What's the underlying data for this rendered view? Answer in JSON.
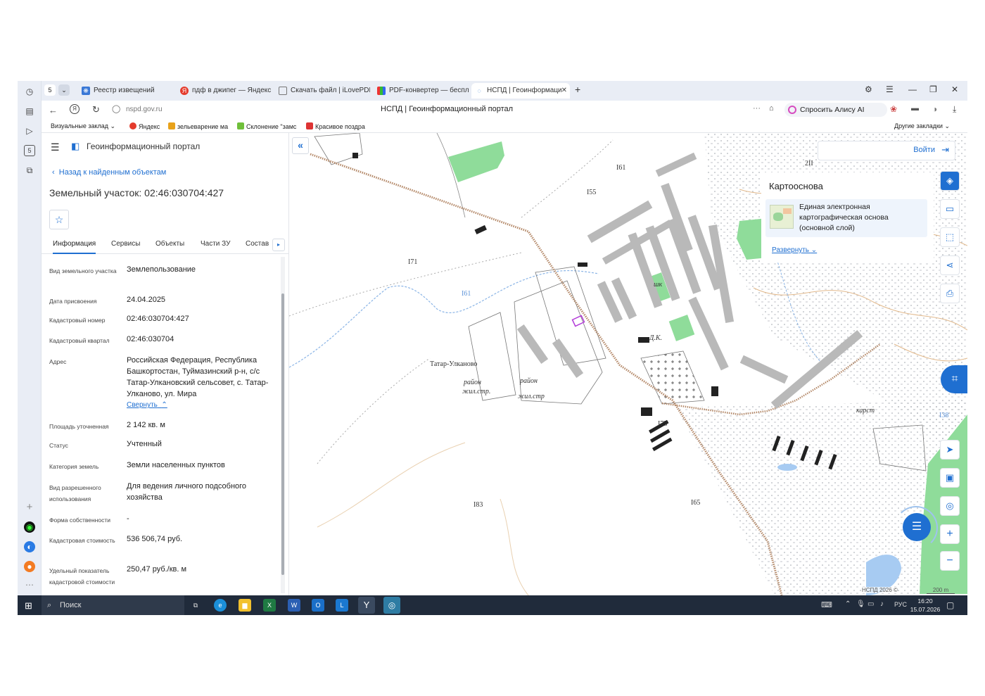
{
  "browser": {
    "tabs": [
      {
        "label": "Реестр извещений",
        "icon": "registry-icon"
      },
      {
        "label": "пдф в джипег — Яндекс:",
        "icon": "yandex-icon"
      },
      {
        "label": "Скачать файл | iLovePDF",
        "icon": "file-icon"
      },
      {
        "label": "PDF-конвертер — беспла",
        "icon": "pdf-icon"
      },
      {
        "label": "НСПД | Геоинформаци",
        "icon": "nspd-icon"
      }
    ],
    "tab_counter": "5",
    "url": "nspd.gov.ru",
    "page_title": "НСПД | Геоинформационный портал",
    "alice_label": "Спросить Алису AI",
    "bookmarks": [
      "Визуальные заклад",
      "Яндекс",
      "зельеварение ма",
      "Склонение \"замс",
      "Красивое поздра"
    ],
    "other_bookmarks": "Другие закладки"
  },
  "panel": {
    "portal_title": "Геоинформационный портал",
    "back_link": "Назад к найденным объектам",
    "object_title": "Земельный участок: 02:46:030704:427",
    "tabs": [
      "Информация",
      "Сервисы",
      "Объекты",
      "Части ЗУ",
      "Состав"
    ],
    "fields": [
      {
        "label": "Вид земельного участка",
        "value": "Землепользование"
      },
      {
        "label": "Дата присвоения",
        "value": "24.04.2025"
      },
      {
        "label": "Кадастровый номер",
        "value": "02:46:030704:427"
      },
      {
        "label": "Кадастровый квартал",
        "value": "02:46:030704"
      },
      {
        "label": "Адрес",
        "value": "Российская Федерация, Республика Башкортостан, Туймазинский р-н, с/с Татар-Улкановский сельсовет, с. Татар-Улканово, ул. Мира"
      },
      {
        "label": "Площадь уточненная",
        "value": "2 142 кв. м"
      },
      {
        "label": "Статус",
        "value": "Учтенный"
      },
      {
        "label": "Категория земель",
        "value": "Земли населенных пунктов"
      },
      {
        "label": "Вид разрешенного использования",
        "value": "Для ведения личного подсобного хозяйства"
      },
      {
        "label": "Форма собственности",
        "value": "-"
      },
      {
        "label": "Кадастровая стоимость",
        "value": "536 506,74 руб."
      },
      {
        "label": "Удельный показатель кадастровой стоимости",
        "value": "250,47 руб./кв. м"
      }
    ],
    "collapse_link": "Свернуть"
  },
  "map": {
    "labels": {
      "elev_161a": "I61",
      "elev_155": "I55",
      "elev_171": "I71",
      "elev_161b": "I61",
      "elev_211": "2II",
      "village": "Татар-Улканово",
      "district1": "район",
      "district1b": "жил.стр.",
      "district2": "район",
      "district2b": "жил.стр",
      "elev_173": "I73",
      "karst": "карст",
      "elev_138": "I38",
      "elev_183": "I83",
      "elev_165": "I65",
      "dk": "Д.К.",
      "shk": "шк"
    },
    "login_label": "Войти",
    "basemap_title": "Картооснова",
    "basemap_layer": "Единая электронная картографическая основа (основной слой)",
    "expand_link": "Развернуть",
    "copyright": "НСПД 2026 ©",
    "scale": "200 m",
    "colors": {
      "accent": "#1f6fd1",
      "green": "#8fdc9a",
      "road": "#b58a6a"
    }
  },
  "taskbar": {
    "search": "Поиск",
    "lang": "РУС",
    "time": "16:20",
    "date": "15.07.2026"
  }
}
